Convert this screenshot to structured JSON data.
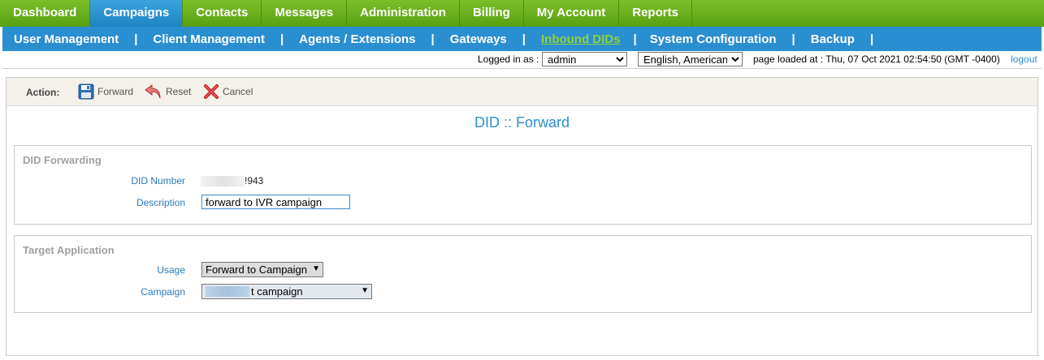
{
  "topnav": {
    "tabs": [
      "Dashboard",
      "Campaigns",
      "Contacts",
      "Messages",
      "Administration",
      "Billing",
      "My Account",
      "Reports"
    ],
    "active": "Campaigns"
  },
  "subnav": {
    "items": [
      "User Management",
      "Client Management",
      "Agents / Extensions",
      "Gateways",
      "Inbound DIDs",
      "System Configuration",
      "Backup"
    ],
    "active": "Inbound DIDs"
  },
  "status": {
    "logged_in_label": "Logged in as :",
    "user": "admin",
    "language": "English, American",
    "loaded": "page loaded at : Thu, 07 Oct 2021 02:54:50 (GMT -0400)",
    "logout": "logout"
  },
  "actions": {
    "label": "Action:",
    "forward": "Forward",
    "reset": "Reset",
    "cancel": "Cancel"
  },
  "page": {
    "title": "DID :: Forward"
  },
  "did_forwarding": {
    "legend": "DID Forwarding",
    "did_number_label": "DID Number",
    "did_number_suffix": "!943",
    "description_label": "Description",
    "description_value": "forward to IVR campaign"
  },
  "target_application": {
    "legend": "Target Application",
    "usage_label": "Usage",
    "usage_value": "Forward to Campaign",
    "campaign_label": "Campaign",
    "campaign_value": "t campaign"
  },
  "colors": {
    "nav_green": "#6cb321",
    "nav_blue": "#2a8fd0",
    "active_subnav": "#8cd23a",
    "label_blue": "#2a7ab8"
  }
}
